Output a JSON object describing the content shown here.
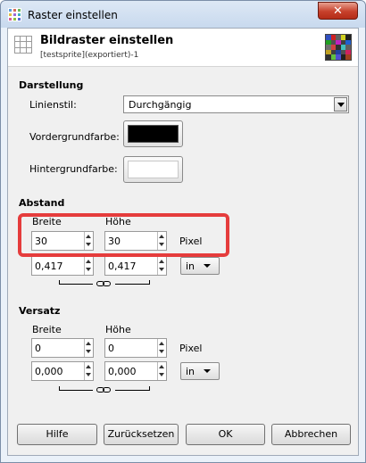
{
  "window": {
    "title": "Raster einstellen",
    "close_glyph": "✕"
  },
  "header": {
    "title": "Bildraster einstellen",
    "subtitle": "[testsprite](exportiert)-1"
  },
  "darstellung": {
    "section_title": "Darstellung",
    "linienstil_label": "Linienstil:",
    "linienstil_value": "Durchgängig",
    "vordergrund_label": "Vordergrundfarbe:",
    "vordergrund_color": "#000000",
    "hintergrund_label": "Hintergrundfarbe:",
    "hintergrund_color": "#ffffff"
  },
  "abstand": {
    "section_title": "Abstand",
    "breite_label": "Breite",
    "hoehe_label": "Höhe",
    "breite_px": "30",
    "hoehe_px": "30",
    "px_unit": "Pixel",
    "breite_in": "0,417",
    "hoehe_in": "0,417",
    "in_unit": "in"
  },
  "versatz": {
    "section_title": "Versatz",
    "breite_label": "Breite",
    "hoehe_label": "Höhe",
    "breite_px": "0",
    "hoehe_px": "0",
    "px_unit": "Pixel",
    "breite_in": "0,000",
    "hoehe_in": "0,000",
    "in_unit": "in"
  },
  "buttons": {
    "help": "Hilfe",
    "reset": "Zurücksetzen",
    "ok": "OK",
    "cancel": "Abbrechen"
  },
  "colors": {
    "highlight": "#e53c3c"
  }
}
